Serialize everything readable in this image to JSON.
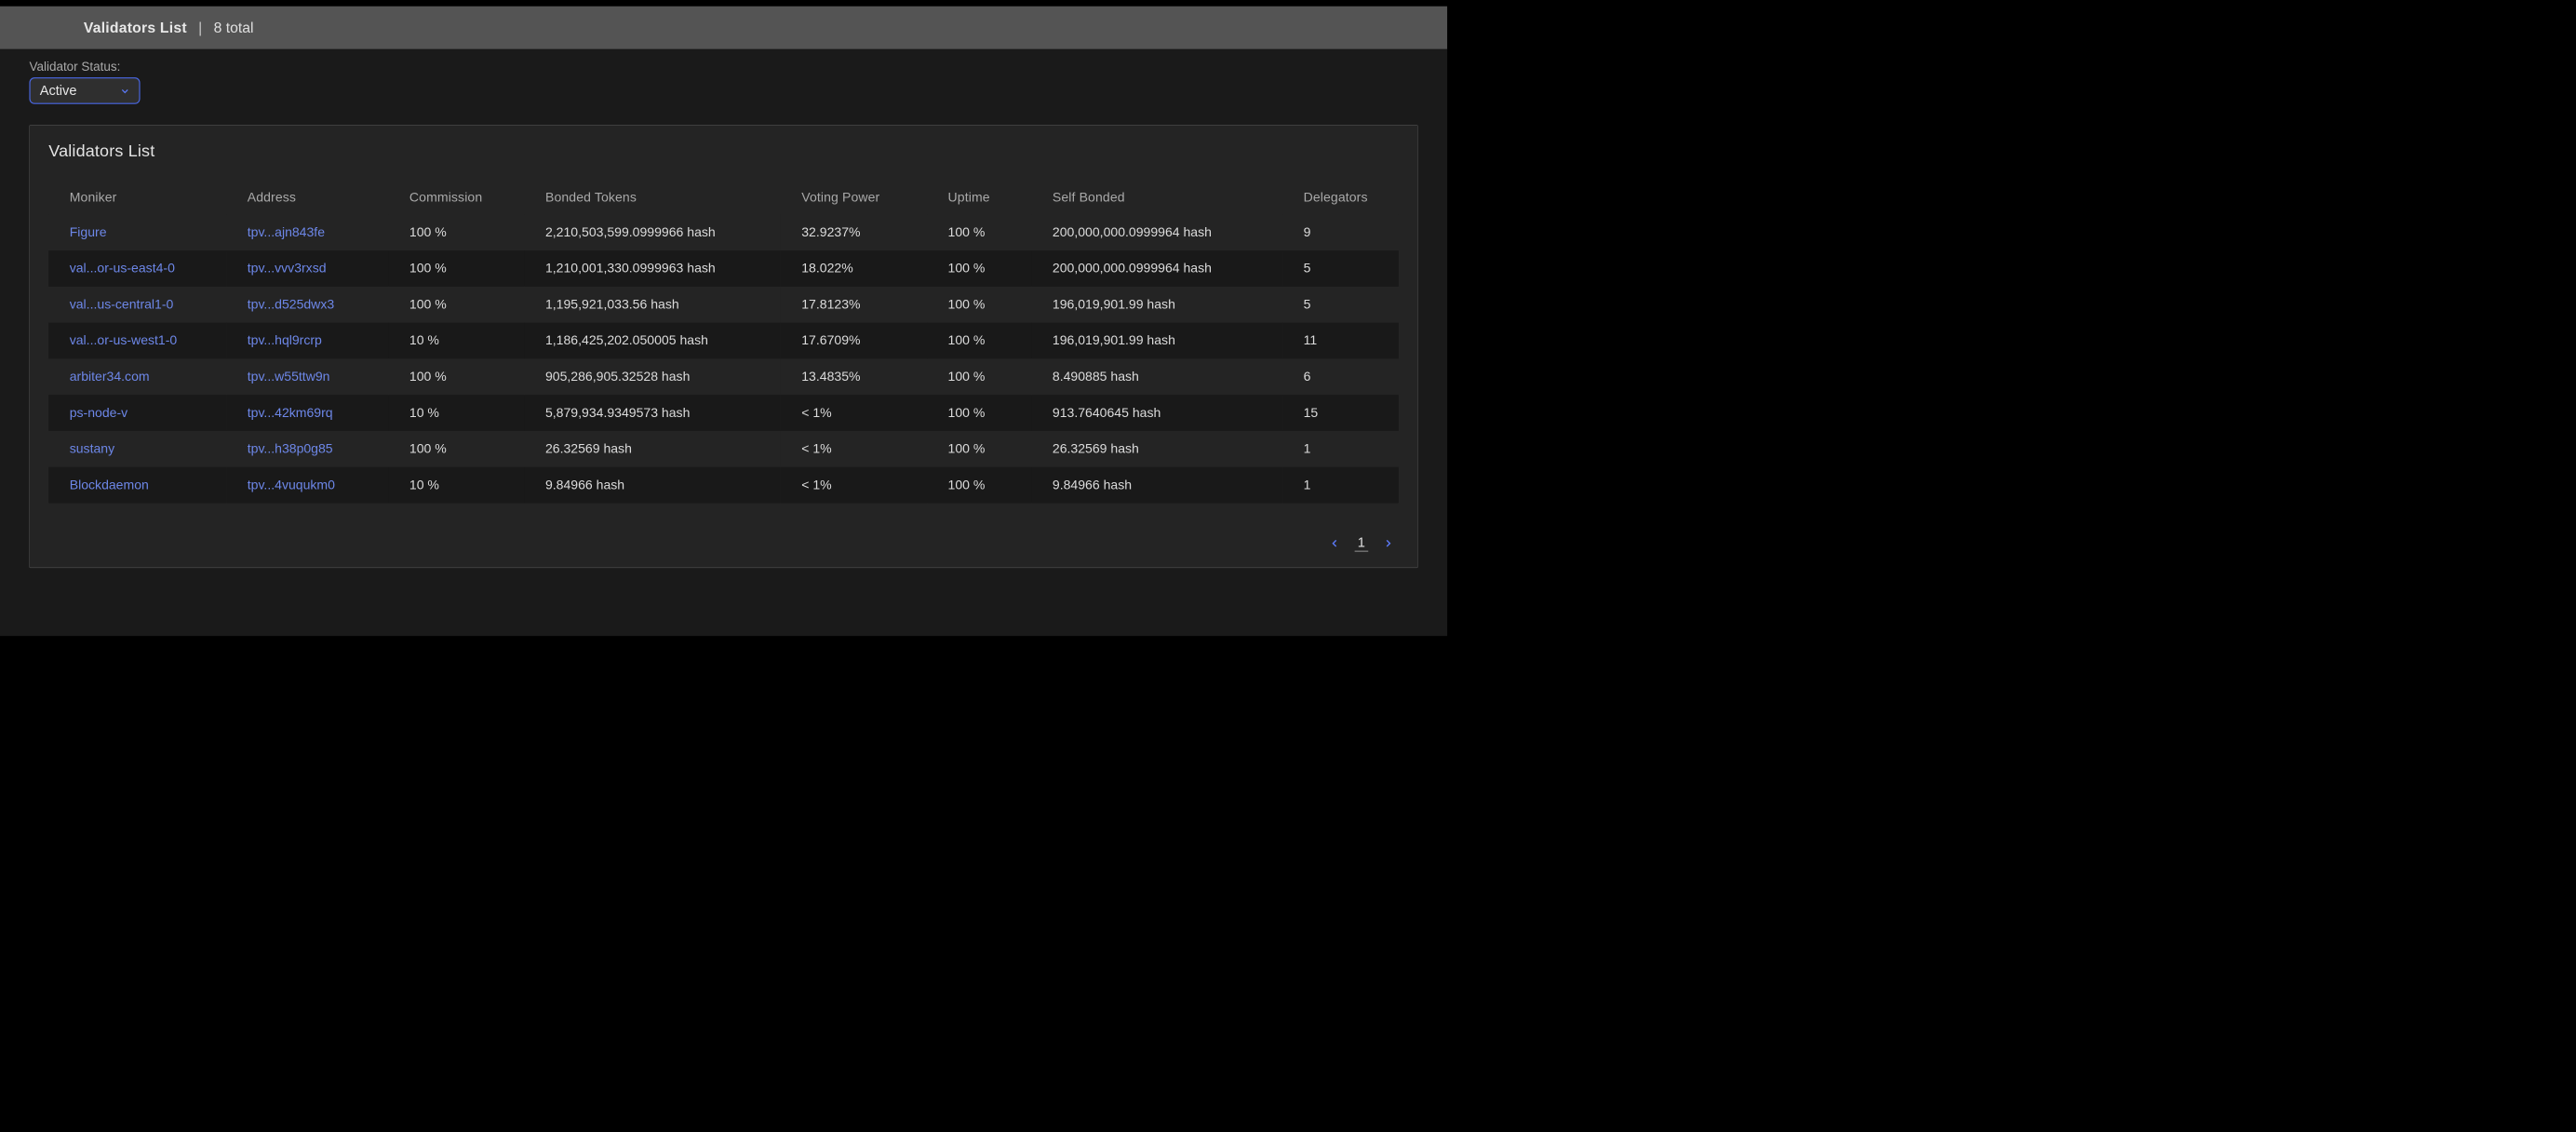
{
  "header": {
    "title": "Validators List",
    "separator": "|",
    "count_text": "8 total"
  },
  "filter": {
    "label": "Validator Status:",
    "value": "Active"
  },
  "panel": {
    "title": "Validators List"
  },
  "columns": {
    "moniker": "Moniker",
    "address": "Address",
    "commission": "Commission",
    "bonded": "Bonded Tokens",
    "voting": "Voting Power",
    "uptime": "Uptime",
    "self": "Self Bonded",
    "delegators": "Delegators"
  },
  "rows": [
    {
      "moniker": "Figure",
      "address": "tpv...ajn843fe",
      "commission": "100 %",
      "bonded": "2,210,503,599.0999966 hash",
      "voting": "32.9237%",
      "uptime": "100 %",
      "self": "200,000,000.0999964 hash",
      "delegators": "9"
    },
    {
      "moniker": "val...or-us-east4-0",
      "address": "tpv...vvv3rxsd",
      "commission": "100 %",
      "bonded": "1,210,001,330.0999963 hash",
      "voting": "18.022%",
      "uptime": "100 %",
      "self": "200,000,000.0999964 hash",
      "delegators": "5"
    },
    {
      "moniker": "val...us-central1-0",
      "address": "tpv...d525dwx3",
      "commission": "100 %",
      "bonded": "1,195,921,033.56 hash",
      "voting": "17.8123%",
      "uptime": "100 %",
      "self": "196,019,901.99 hash",
      "delegators": "5"
    },
    {
      "moniker": "val...or-us-west1-0",
      "address": "tpv...hql9rcrp",
      "commission": "10 %",
      "bonded": "1,186,425,202.050005 hash",
      "voting": "17.6709%",
      "uptime": "100 %",
      "self": "196,019,901.99 hash",
      "delegators": "11"
    },
    {
      "moniker": "arbiter34.com",
      "address": "tpv...w55ttw9n",
      "commission": "100 %",
      "bonded": "905,286,905.32528 hash",
      "voting": "13.4835%",
      "uptime": "100 %",
      "self": "8.490885 hash",
      "delegators": "6"
    },
    {
      "moniker": "ps-node-v",
      "address": "tpv...42km69rq",
      "commission": "10 %",
      "bonded": "5,879,934.9349573 hash",
      "voting": "< 1%",
      "uptime": "100 %",
      "self": "913.7640645 hash",
      "delegators": "15"
    },
    {
      "moniker": "sustany",
      "address": "tpv...h38p0g85",
      "commission": "100 %",
      "bonded": "26.32569 hash",
      "voting": "< 1%",
      "uptime": "100 %",
      "self": "26.32569 hash",
      "delegators": "1"
    },
    {
      "moniker": "Blockdaemon",
      "address": "tpv...4vuqukm0",
      "commission": "10 %",
      "bonded": "9.84966 hash",
      "voting": "< 1%",
      "uptime": "100 %",
      "self": "9.84966 hash",
      "delegators": "1"
    }
  ],
  "pager": {
    "page": "1"
  }
}
